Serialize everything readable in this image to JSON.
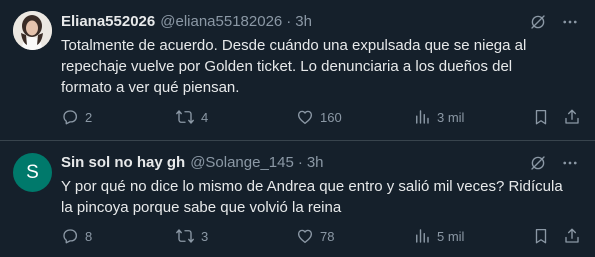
{
  "tweets": [
    {
      "display_name": "Eliana552026",
      "handle": "@eliana55182026",
      "separator": "·",
      "time": "3h",
      "avatar": {
        "type": "photo"
      },
      "text_lines": [
        "Totalmente de acuerdo. Desde cuándo una expulsada que se niega al",
        "repechaje vuelve por Golden ticket. Lo denunciaria a los dueños del",
        "formato a ver qué piensan."
      ],
      "stats": {
        "replies": "2",
        "retweets": "4",
        "likes": "160",
        "views": "3 mil"
      }
    },
    {
      "display_name": "Sin sol no hay gh",
      "handle": "@Solange_145",
      "separator": "·",
      "time": "3h",
      "avatar": {
        "type": "initial",
        "initial": "S",
        "color": "#00796b"
      },
      "text_lines": [
        "Y por qué no dice lo mismo de Andrea que entro y salió mil veces? Ridícula",
        "la pincoya porque sabe que volvió la reina"
      ],
      "stats": {
        "replies": "8",
        "retweets": "3",
        "likes": "78",
        "views": "5 mil"
      }
    }
  ],
  "colors": {
    "background": "#15202b",
    "text": "#e7e9ea",
    "muted": "#8b98a5",
    "divider": "#38444d"
  },
  "icons": [
    "grok-icon",
    "more-icon",
    "reply-icon",
    "retweet-icon",
    "like-icon",
    "views-icon",
    "bookmark-icon",
    "share-icon"
  ]
}
